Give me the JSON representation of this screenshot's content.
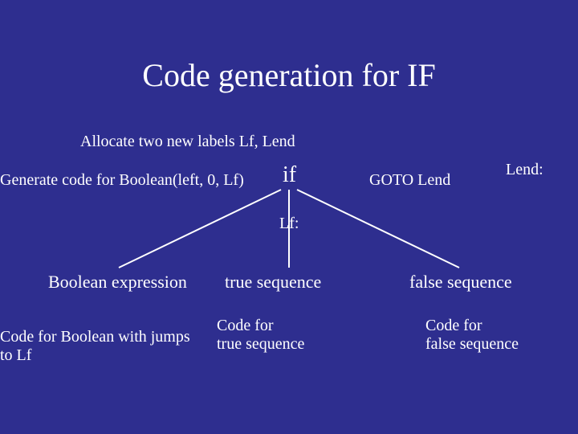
{
  "title": "Code generation for IF",
  "allocate": "Allocate two new labels Lf, Lend",
  "gen_boolean": "Generate code for Boolean(left, 0, Lf)",
  "if_node": "if",
  "goto_lend": "GOTO Lend",
  "lend_label": "Lend:",
  "lf_label": "Lf:",
  "children": {
    "boolean_expression": "Boolean expression",
    "true_sequence": "true sequence",
    "false_sequence": "false sequence"
  },
  "code_bool_jumps_l1": "Code for Boolean with jumps",
  "code_bool_jumps_l2": "to Lf",
  "code_true_l1": "Code for",
  "code_true_l2": "true sequence",
  "code_false_l1": "Code for",
  "code_false_l2": "false sequence"
}
